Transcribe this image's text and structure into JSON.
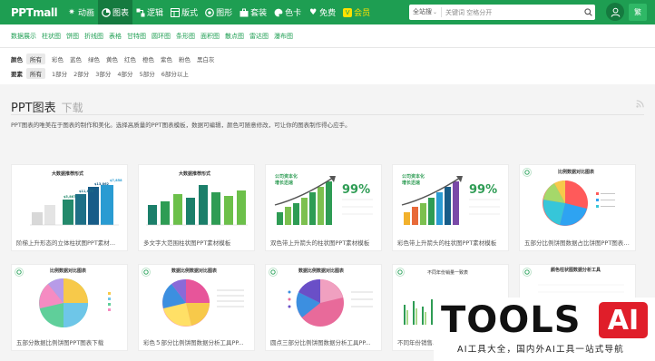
{
  "brand": {
    "logo": "PPTmall"
  },
  "nav": [
    {
      "label": "动画",
      "icon": "sparkle-icon",
      "active": false
    },
    {
      "label": "图表",
      "icon": "pie-chart-icon",
      "active": true
    },
    {
      "label": "逻辑",
      "icon": "logic-icon",
      "active": false
    },
    {
      "label": "版式",
      "icon": "layout-icon",
      "active": false
    },
    {
      "label": "图形",
      "icon": "shape-icon",
      "active": false
    },
    {
      "label": "套装",
      "icon": "briefcase-icon",
      "active": false
    },
    {
      "label": "色卡",
      "icon": "palette-icon",
      "active": false
    },
    {
      "label": "免费",
      "icon": "heart-icon",
      "active": false
    },
    {
      "label": "会员",
      "icon": "vip-icon",
      "active": false
    }
  ],
  "search": {
    "scope": "全站搜",
    "placeholder": "关键词 空格分开"
  },
  "lang_button": "繁",
  "categories": [
    "数据展示",
    "柱状图",
    "饼图",
    "折线图",
    "表格",
    "甘特图",
    "圆环图",
    "条形图",
    "面积图",
    "散点图",
    "雷达图",
    "瀑布图"
  ],
  "filters": {
    "color": {
      "label": "颜色",
      "options": [
        "所有",
        "彩色",
        "蓝色",
        "绿色",
        "黄色",
        "红色",
        "橙色",
        "紫色",
        "粉色",
        "黑白灰"
      ]
    },
    "elements": {
      "label": "要素",
      "options": [
        "所有",
        "1部分",
        "2部分",
        "3部分",
        "4部分",
        "5部分",
        "6部分以上"
      ]
    }
  },
  "page": {
    "title": "PPT图表",
    "subtitle": "下载",
    "description": "PPT图表的唯美在于图表的制作和美化。选择高质量的PPT图表模板，数据可编辑，颜色可随意修改，可让你的图表制作得心应手。"
  },
  "cards": [
    {
      "caption": "阶梯上升形态的立体柱状图PPT素材...",
      "thumb_title": "大数据推荐形式",
      "values": [
        "$5,867",
        "$11,879",
        "$13,862",
        "$7,858"
      ]
    },
    {
      "caption": "多文字大范围柱状图PPT素材模板",
      "thumb_title": "大数据推荐形式"
    },
    {
      "caption": "双色带上升箭头的柱状图PPT素材模板",
      "thumb_title": "公司资本化",
      "thumb_subtitle": "增长迅速",
      "percent": "99%"
    },
    {
      "caption": "彩色带上升箭头的柱状图PPT素材模板",
      "thumb_title": "公司资本化",
      "thumb_subtitle": "增长迅速",
      "percent": "99%"
    },
    {
      "caption": "五部分比例饼图数据占比饼图PPT图表下载",
      "thumb_title": "比例数据对比图表"
    },
    {
      "caption": "五部分数据比例饼图PPT图表下载",
      "thumb_title": "比例数据对比图表"
    },
    {
      "caption": "彩色５部分比例饼图数据分析工具PP...",
      "thumb_title": "数据比例数据对比图表"
    },
    {
      "caption": "圆点三部分比例饼图数据分析工具PP...",
      "thumb_title": "数据比例数据对比图表"
    },
    {
      "caption": "不同年份销售...",
      "thumb_title": "不同年份销量一致表"
    },
    {
      "caption": "",
      "thumb_title": "颜色柱状图数据分析工具"
    }
  ],
  "watermark": {
    "tools": "TOOLS",
    "ai": "AI",
    "slogan": "AI工具大全，国内外AI工具一站式导航"
  }
}
